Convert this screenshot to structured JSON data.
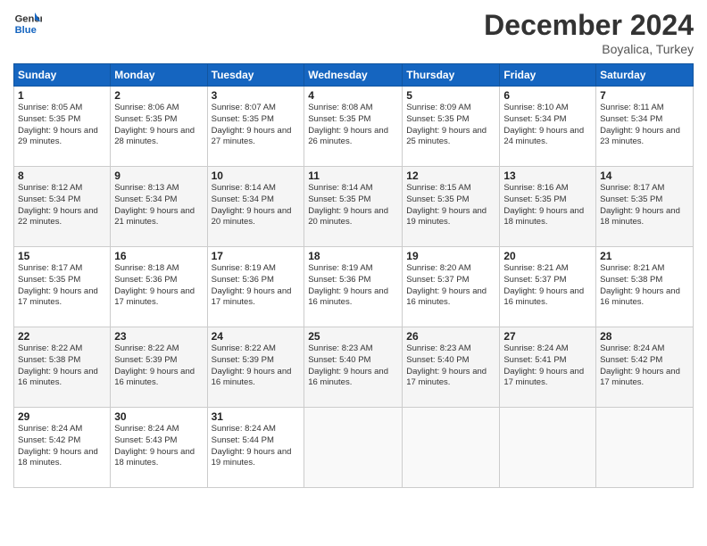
{
  "header": {
    "logo_line1": "General",
    "logo_line2": "Blue",
    "month": "December 2024",
    "location": "Boyalica, Turkey"
  },
  "weekdays": [
    "Sunday",
    "Monday",
    "Tuesday",
    "Wednesday",
    "Thursday",
    "Friday",
    "Saturday"
  ],
  "weeks": [
    [
      {
        "day": "1",
        "sunrise": "8:05 AM",
        "sunset": "5:35 PM",
        "daylight": "9 hours and 29 minutes."
      },
      {
        "day": "2",
        "sunrise": "8:06 AM",
        "sunset": "5:35 PM",
        "daylight": "9 hours and 28 minutes."
      },
      {
        "day": "3",
        "sunrise": "8:07 AM",
        "sunset": "5:35 PM",
        "daylight": "9 hours and 27 minutes."
      },
      {
        "day": "4",
        "sunrise": "8:08 AM",
        "sunset": "5:35 PM",
        "daylight": "9 hours and 26 minutes."
      },
      {
        "day": "5",
        "sunrise": "8:09 AM",
        "sunset": "5:35 PM",
        "daylight": "9 hours and 25 minutes."
      },
      {
        "day": "6",
        "sunrise": "8:10 AM",
        "sunset": "5:34 PM",
        "daylight": "9 hours and 24 minutes."
      },
      {
        "day": "7",
        "sunrise": "8:11 AM",
        "sunset": "5:34 PM",
        "daylight": "9 hours and 23 minutes."
      }
    ],
    [
      {
        "day": "8",
        "sunrise": "8:12 AM",
        "sunset": "5:34 PM",
        "daylight": "9 hours and 22 minutes."
      },
      {
        "day": "9",
        "sunrise": "8:13 AM",
        "sunset": "5:34 PM",
        "daylight": "9 hours and 21 minutes."
      },
      {
        "day": "10",
        "sunrise": "8:14 AM",
        "sunset": "5:34 PM",
        "daylight": "9 hours and 20 minutes."
      },
      {
        "day": "11",
        "sunrise": "8:14 AM",
        "sunset": "5:35 PM",
        "daylight": "9 hours and 20 minutes."
      },
      {
        "day": "12",
        "sunrise": "8:15 AM",
        "sunset": "5:35 PM",
        "daylight": "9 hours and 19 minutes."
      },
      {
        "day": "13",
        "sunrise": "8:16 AM",
        "sunset": "5:35 PM",
        "daylight": "9 hours and 18 minutes."
      },
      {
        "day": "14",
        "sunrise": "8:17 AM",
        "sunset": "5:35 PM",
        "daylight": "9 hours and 18 minutes."
      }
    ],
    [
      {
        "day": "15",
        "sunrise": "8:17 AM",
        "sunset": "5:35 PM",
        "daylight": "9 hours and 17 minutes."
      },
      {
        "day": "16",
        "sunrise": "8:18 AM",
        "sunset": "5:36 PM",
        "daylight": "9 hours and 17 minutes."
      },
      {
        "day": "17",
        "sunrise": "8:19 AM",
        "sunset": "5:36 PM",
        "daylight": "9 hours and 17 minutes."
      },
      {
        "day": "18",
        "sunrise": "8:19 AM",
        "sunset": "5:36 PM",
        "daylight": "9 hours and 16 minutes."
      },
      {
        "day": "19",
        "sunrise": "8:20 AM",
        "sunset": "5:37 PM",
        "daylight": "9 hours and 16 minutes."
      },
      {
        "day": "20",
        "sunrise": "8:21 AM",
        "sunset": "5:37 PM",
        "daylight": "9 hours and 16 minutes."
      },
      {
        "day": "21",
        "sunrise": "8:21 AM",
        "sunset": "5:38 PM",
        "daylight": "9 hours and 16 minutes."
      }
    ],
    [
      {
        "day": "22",
        "sunrise": "8:22 AM",
        "sunset": "5:38 PM",
        "daylight": "9 hours and 16 minutes."
      },
      {
        "day": "23",
        "sunrise": "8:22 AM",
        "sunset": "5:39 PM",
        "daylight": "9 hours and 16 minutes."
      },
      {
        "day": "24",
        "sunrise": "8:22 AM",
        "sunset": "5:39 PM",
        "daylight": "9 hours and 16 minutes."
      },
      {
        "day": "25",
        "sunrise": "8:23 AM",
        "sunset": "5:40 PM",
        "daylight": "9 hours and 16 minutes."
      },
      {
        "day": "26",
        "sunrise": "8:23 AM",
        "sunset": "5:40 PM",
        "daylight": "9 hours and 17 minutes."
      },
      {
        "day": "27",
        "sunrise": "8:24 AM",
        "sunset": "5:41 PM",
        "daylight": "9 hours and 17 minutes."
      },
      {
        "day": "28",
        "sunrise": "8:24 AM",
        "sunset": "5:42 PM",
        "daylight": "9 hours and 17 minutes."
      }
    ],
    [
      {
        "day": "29",
        "sunrise": "8:24 AM",
        "sunset": "5:42 PM",
        "daylight": "9 hours and 18 minutes."
      },
      {
        "day": "30",
        "sunrise": "8:24 AM",
        "sunset": "5:43 PM",
        "daylight": "9 hours and 18 minutes."
      },
      {
        "day": "31",
        "sunrise": "8:24 AM",
        "sunset": "5:44 PM",
        "daylight": "9 hours and 19 minutes."
      },
      null,
      null,
      null,
      null
    ]
  ]
}
